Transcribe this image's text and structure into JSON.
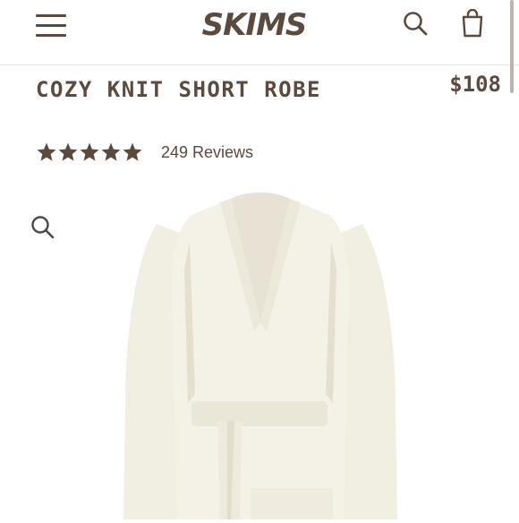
{
  "header": {
    "brand": "SKIMS",
    "menu_icon": "hamburger-menu-icon",
    "search_icon": "search-icon",
    "bag_icon": "shopping-bag-icon"
  },
  "product": {
    "title": "COZY KNIT SHORT ROBE",
    "price": "$108",
    "rating": 5,
    "reviews_text": "249 Reviews",
    "zoom_icon": "zoom-icon",
    "image_subject": "cream knit short robe with tie belt"
  },
  "colors": {
    "brand_text": "#5b4a3e",
    "robe": "#f3f0e4",
    "robe_shadow": "#ddd8c8",
    "border": "#e6e2dd"
  }
}
